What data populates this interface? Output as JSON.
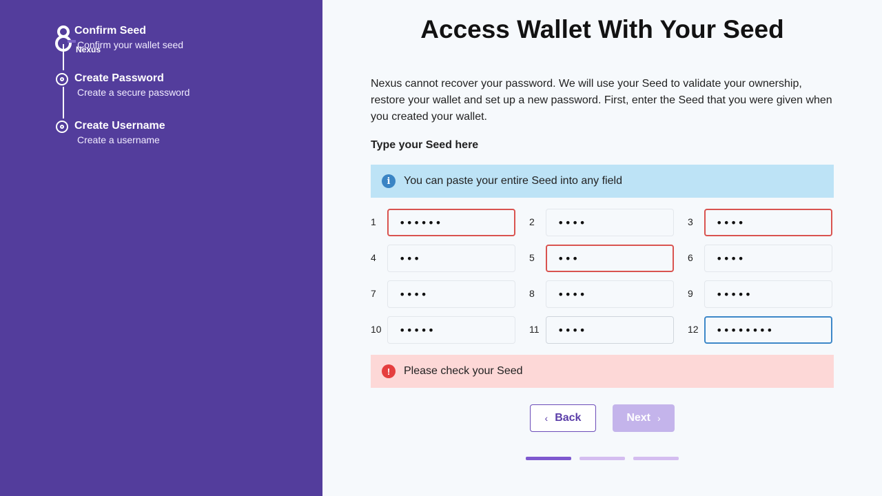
{
  "sidebar": {
    "logo_text": "Nexus",
    "steps": [
      {
        "title": "Confirm Seed",
        "subtitle": "Confirm your wallet seed"
      },
      {
        "title": "Create Password",
        "subtitle": "Create a secure password"
      },
      {
        "title": "Create Username",
        "subtitle": "Create a username"
      }
    ]
  },
  "main": {
    "title": "Access Wallet With Your Seed",
    "description": "Nexus cannot recover your password. We will use your Seed to validate your ownership, restore your wallet and set up a new password. First, enter the Seed that you were given when you created your wallet.",
    "seed_label": "Type your Seed here",
    "info_banner": "You can paste your entire Seed into any field",
    "info_icon": "info-icon",
    "seed_fields": [
      {
        "number": "1",
        "value": "••••••",
        "state": "error"
      },
      {
        "number": "2",
        "value": "••••",
        "state": "normal"
      },
      {
        "number": "3",
        "value": "••••",
        "state": "error"
      },
      {
        "number": "4",
        "value": "•••",
        "state": "normal"
      },
      {
        "number": "5",
        "value": "•••",
        "state": "error"
      },
      {
        "number": "6",
        "value": "••••",
        "state": "normal"
      },
      {
        "number": "7",
        "value": "••••",
        "state": "normal"
      },
      {
        "number": "8",
        "value": "••••",
        "state": "normal"
      },
      {
        "number": "9",
        "value": "•••••",
        "state": "normal"
      },
      {
        "number": "10",
        "value": "•••••",
        "state": "normal"
      },
      {
        "number": "11",
        "value": "••••",
        "state": "plain"
      },
      {
        "number": "12",
        "value": "••••••••",
        "state": "focus"
      }
    ],
    "error_banner": "Please check your Seed",
    "error_icon_glyph": "!",
    "back_label": "Back",
    "next_label": "Next",
    "progress_steps": 3,
    "progress_active": 1
  },
  "colors": {
    "sidebar": "#533d9c",
    "accent": "#6a4bb8",
    "error": "#d9534f",
    "focus": "#3c87c8",
    "info_bg": "#bde3f6",
    "error_bg": "#fdd8d7"
  }
}
